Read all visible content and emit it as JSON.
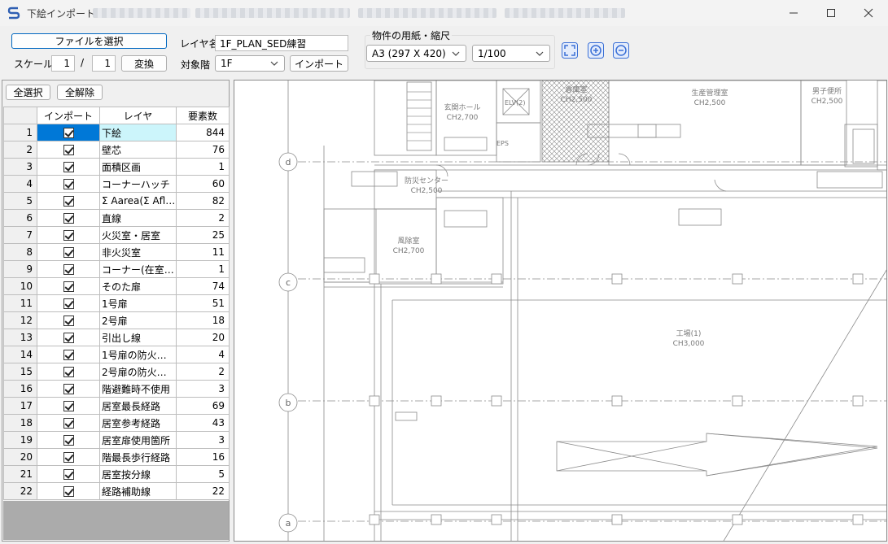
{
  "window": {
    "title": "下絵インポート",
    "app_icon": "app-s-icon",
    "minimize_icon": "minimize-icon",
    "maximize_icon": "maximize-icon",
    "close_icon": "close-icon"
  },
  "toolbar": {
    "select_file_label": "ファイルを選択",
    "scale_label": "スケール",
    "scale_numerator": "1",
    "scale_separator": "/",
    "scale_denominator": "1",
    "convert_label": "変換",
    "layer_name_label": "レイヤ名",
    "layer_name_value": "1F_PLAN_SED練習",
    "target_floor_label": "対象階",
    "target_floor_value": "1F",
    "import_label": "インポート",
    "paper_group_title": "物件の用紙・縮尺",
    "paper_size_value": "A3 (297 X 420)",
    "paper_scale_value": "1/100",
    "fit_icon": "zoom-fit-icon",
    "zoom_in_icon": "zoom-in-icon",
    "zoom_out_icon": "zoom-out-icon"
  },
  "layers": {
    "select_all_label": "全選択",
    "clear_all_label": "全解除",
    "columns": [
      "インポート",
      "レイヤ",
      "要素数"
    ],
    "rows": [
      {
        "no": "1",
        "name": "下絵",
        "count": "844"
      },
      {
        "no": "2",
        "name": "壁芯",
        "count": "76"
      },
      {
        "no": "3",
        "name": "面積区画",
        "count": "1"
      },
      {
        "no": "4",
        "name": "コーナーハッチ",
        "count": "60"
      },
      {
        "no": "5",
        "name": "Σ Aarea(Σ Aflo...",
        "count": "82"
      },
      {
        "no": "6",
        "name": "直線",
        "count": "2"
      },
      {
        "no": "7",
        "name": "火災室・居室",
        "count": "25"
      },
      {
        "no": "8",
        "name": "非火災室",
        "count": "11"
      },
      {
        "no": "9",
        "name": "コーナー(在室者...",
        "count": "1"
      },
      {
        "no": "10",
        "name": "そのた扉",
        "count": "74"
      },
      {
        "no": "11",
        "name": "1号扉",
        "count": "51"
      },
      {
        "no": "12",
        "name": "2号扉",
        "count": "18"
      },
      {
        "no": "13",
        "name": "引出し線",
        "count": "20"
      },
      {
        "no": "14",
        "name": "1号扉の防火記...",
        "count": "4"
      },
      {
        "no": "15",
        "name": "2号扉の防火記...",
        "count": "2"
      },
      {
        "no": "16",
        "name": "階避難時不使用",
        "count": "3"
      },
      {
        "no": "17",
        "name": "居室最長経路",
        "count": "69"
      },
      {
        "no": "18",
        "name": "居室参考経路",
        "count": "43"
      },
      {
        "no": "19",
        "name": "居室扉使用箇所",
        "count": "3"
      },
      {
        "no": "20",
        "name": "階最長歩行経路",
        "count": "16"
      },
      {
        "no": "21",
        "name": "居室按分線",
        "count": "5"
      },
      {
        "no": "22",
        "name": "経路補助線",
        "count": "22"
      }
    ]
  },
  "drawing": {
    "rooms": [
      {
        "name": "玄関ホール",
        "height": "CH2,700"
      },
      {
        "name": "生産管理室",
        "height": "CH2,500"
      },
      {
        "name": "男子便所",
        "height": "CH2,500"
      },
      {
        "name": "防災センター",
        "height": "CH2,500"
      },
      {
        "name": "風除室",
        "height": "CH2,700"
      },
      {
        "name": "工場(1)",
        "height": "CH3,000"
      },
      {
        "name": "倉庫室",
        "height": "CH2,500"
      }
    ],
    "labels": {
      "eps": "EPS",
      "elv": "ELV(2)",
      "grid_d": "d",
      "grid_c": "c",
      "grid_b": "b",
      "grid_a": "a"
    }
  }
}
